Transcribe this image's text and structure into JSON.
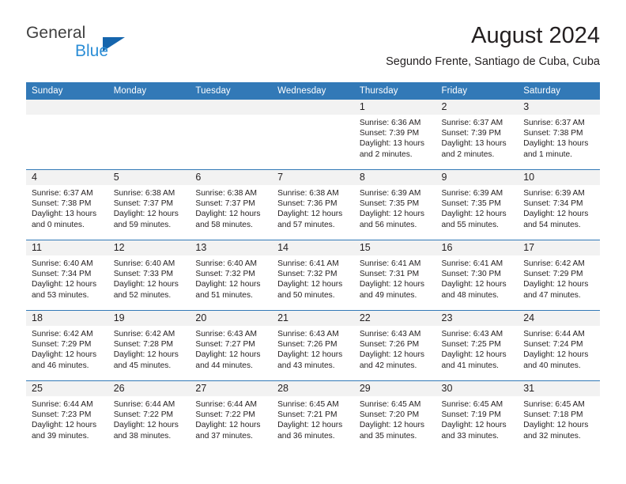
{
  "brand": {
    "name_top": "General",
    "name_bottom": "Blue",
    "color_dark": "#3f3f3f",
    "color_blue": "#2c8ed6",
    "triangle_color": "#1565ad"
  },
  "header": {
    "title": "August 2024",
    "subtitle": "Segundo Frente, Santiago de Cuba, Cuba"
  },
  "theme": {
    "header_row_bg": "#3279b7",
    "header_row_text": "#ffffff",
    "daynum_band_bg": "#f2f2f2",
    "row_divider": "#3279b7",
    "body_text": "#231f20"
  },
  "weekdays": [
    "Sunday",
    "Monday",
    "Tuesday",
    "Wednesday",
    "Thursday",
    "Friday",
    "Saturday"
  ],
  "labels": {
    "sunrise_prefix": "Sunrise:",
    "sunset_prefix": "Sunset:",
    "daylight_prefix": "Daylight:"
  },
  "weeks": [
    [
      {
        "day": "",
        "lines": []
      },
      {
        "day": "",
        "lines": []
      },
      {
        "day": "",
        "lines": []
      },
      {
        "day": "",
        "lines": []
      },
      {
        "day": "1",
        "lines": [
          "Sunrise: 6:36 AM",
          "Sunset: 7:39 PM",
          "Daylight: 13 hours",
          "and 2 minutes."
        ]
      },
      {
        "day": "2",
        "lines": [
          "Sunrise: 6:37 AM",
          "Sunset: 7:39 PM",
          "Daylight: 13 hours",
          "and 2 minutes."
        ]
      },
      {
        "day": "3",
        "lines": [
          "Sunrise: 6:37 AM",
          "Sunset: 7:38 PM",
          "Daylight: 13 hours",
          "and 1 minute."
        ]
      }
    ],
    [
      {
        "day": "4",
        "lines": [
          "Sunrise: 6:37 AM",
          "Sunset: 7:38 PM",
          "Daylight: 13 hours",
          "and 0 minutes."
        ]
      },
      {
        "day": "5",
        "lines": [
          "Sunrise: 6:38 AM",
          "Sunset: 7:37 PM",
          "Daylight: 12 hours",
          "and 59 minutes."
        ]
      },
      {
        "day": "6",
        "lines": [
          "Sunrise: 6:38 AM",
          "Sunset: 7:37 PM",
          "Daylight: 12 hours",
          "and 58 minutes."
        ]
      },
      {
        "day": "7",
        "lines": [
          "Sunrise: 6:38 AM",
          "Sunset: 7:36 PM",
          "Daylight: 12 hours",
          "and 57 minutes."
        ]
      },
      {
        "day": "8",
        "lines": [
          "Sunrise: 6:39 AM",
          "Sunset: 7:35 PM",
          "Daylight: 12 hours",
          "and 56 minutes."
        ]
      },
      {
        "day": "9",
        "lines": [
          "Sunrise: 6:39 AM",
          "Sunset: 7:35 PM",
          "Daylight: 12 hours",
          "and 55 minutes."
        ]
      },
      {
        "day": "10",
        "lines": [
          "Sunrise: 6:39 AM",
          "Sunset: 7:34 PM",
          "Daylight: 12 hours",
          "and 54 minutes."
        ]
      }
    ],
    [
      {
        "day": "11",
        "lines": [
          "Sunrise: 6:40 AM",
          "Sunset: 7:34 PM",
          "Daylight: 12 hours",
          "and 53 minutes."
        ]
      },
      {
        "day": "12",
        "lines": [
          "Sunrise: 6:40 AM",
          "Sunset: 7:33 PM",
          "Daylight: 12 hours",
          "and 52 minutes."
        ]
      },
      {
        "day": "13",
        "lines": [
          "Sunrise: 6:40 AM",
          "Sunset: 7:32 PM",
          "Daylight: 12 hours",
          "and 51 minutes."
        ]
      },
      {
        "day": "14",
        "lines": [
          "Sunrise: 6:41 AM",
          "Sunset: 7:32 PM",
          "Daylight: 12 hours",
          "and 50 minutes."
        ]
      },
      {
        "day": "15",
        "lines": [
          "Sunrise: 6:41 AM",
          "Sunset: 7:31 PM",
          "Daylight: 12 hours",
          "and 49 minutes."
        ]
      },
      {
        "day": "16",
        "lines": [
          "Sunrise: 6:41 AM",
          "Sunset: 7:30 PM",
          "Daylight: 12 hours",
          "and 48 minutes."
        ]
      },
      {
        "day": "17",
        "lines": [
          "Sunrise: 6:42 AM",
          "Sunset: 7:29 PM",
          "Daylight: 12 hours",
          "and 47 minutes."
        ]
      }
    ],
    [
      {
        "day": "18",
        "lines": [
          "Sunrise: 6:42 AM",
          "Sunset: 7:29 PM",
          "Daylight: 12 hours",
          "and 46 minutes."
        ]
      },
      {
        "day": "19",
        "lines": [
          "Sunrise: 6:42 AM",
          "Sunset: 7:28 PM",
          "Daylight: 12 hours",
          "and 45 minutes."
        ]
      },
      {
        "day": "20",
        "lines": [
          "Sunrise: 6:43 AM",
          "Sunset: 7:27 PM",
          "Daylight: 12 hours",
          "and 44 minutes."
        ]
      },
      {
        "day": "21",
        "lines": [
          "Sunrise: 6:43 AM",
          "Sunset: 7:26 PM",
          "Daylight: 12 hours",
          "and 43 minutes."
        ]
      },
      {
        "day": "22",
        "lines": [
          "Sunrise: 6:43 AM",
          "Sunset: 7:26 PM",
          "Daylight: 12 hours",
          "and 42 minutes."
        ]
      },
      {
        "day": "23",
        "lines": [
          "Sunrise: 6:43 AM",
          "Sunset: 7:25 PM",
          "Daylight: 12 hours",
          "and 41 minutes."
        ]
      },
      {
        "day": "24",
        "lines": [
          "Sunrise: 6:44 AM",
          "Sunset: 7:24 PM",
          "Daylight: 12 hours",
          "and 40 minutes."
        ]
      }
    ],
    [
      {
        "day": "25",
        "lines": [
          "Sunrise: 6:44 AM",
          "Sunset: 7:23 PM",
          "Daylight: 12 hours",
          "and 39 minutes."
        ]
      },
      {
        "day": "26",
        "lines": [
          "Sunrise: 6:44 AM",
          "Sunset: 7:22 PM",
          "Daylight: 12 hours",
          "and 38 minutes."
        ]
      },
      {
        "day": "27",
        "lines": [
          "Sunrise: 6:44 AM",
          "Sunset: 7:22 PM",
          "Daylight: 12 hours",
          "and 37 minutes."
        ]
      },
      {
        "day": "28",
        "lines": [
          "Sunrise: 6:45 AM",
          "Sunset: 7:21 PM",
          "Daylight: 12 hours",
          "and 36 minutes."
        ]
      },
      {
        "day": "29",
        "lines": [
          "Sunrise: 6:45 AM",
          "Sunset: 7:20 PM",
          "Daylight: 12 hours",
          "and 35 minutes."
        ]
      },
      {
        "day": "30",
        "lines": [
          "Sunrise: 6:45 AM",
          "Sunset: 7:19 PM",
          "Daylight: 12 hours",
          "and 33 minutes."
        ]
      },
      {
        "day": "31",
        "lines": [
          "Sunrise: 6:45 AM",
          "Sunset: 7:18 PM",
          "Daylight: 12 hours",
          "and 32 minutes."
        ]
      }
    ]
  ]
}
